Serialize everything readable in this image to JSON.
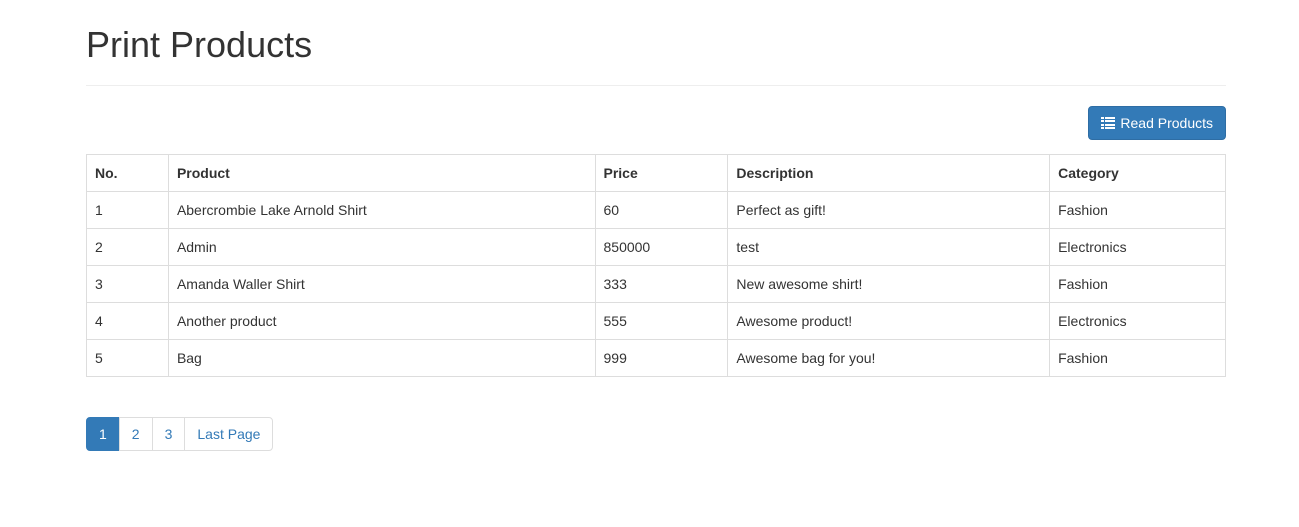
{
  "page": {
    "title": "Print Products"
  },
  "toolbar": {
    "read_products_label": "Read Products",
    "read_products_icon": "list-icon"
  },
  "table": {
    "headers": [
      "No.",
      "Product",
      "Price",
      "Description",
      "Category"
    ],
    "rows": [
      [
        "1",
        "Abercrombie Lake Arnold Shirt",
        "60",
        "Perfect as gift!",
        "Fashion"
      ],
      [
        "2",
        "Admin",
        "850000",
        "test",
        "Electronics"
      ],
      [
        "3",
        "Amanda Waller Shirt",
        "333",
        "New awesome shirt!",
        "Fashion"
      ],
      [
        "4",
        "Another product",
        "555",
        "Awesome product!",
        "Electronics"
      ],
      [
        "5",
        "Bag",
        "999",
        "Awesome bag for you!",
        "Fashion"
      ]
    ]
  },
  "pagination": {
    "pages": [
      "1",
      "2",
      "3"
    ],
    "current": "1",
    "last_label": "Last Page"
  },
  "colors": {
    "primary": "#337ab7",
    "border": "#dddddd",
    "text": "#333333"
  }
}
